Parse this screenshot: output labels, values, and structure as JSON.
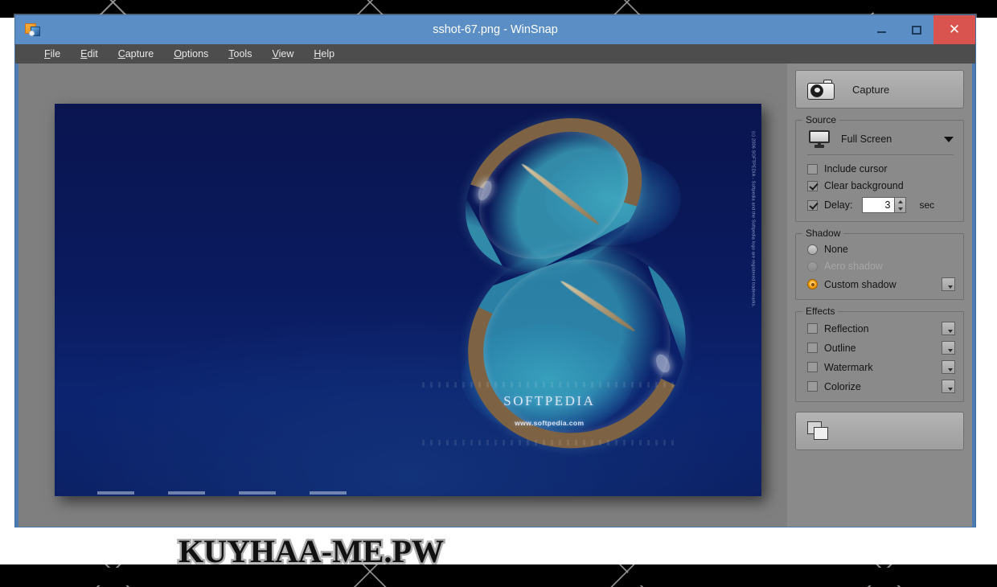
{
  "window": {
    "title": "sshot-67.png - WinSnap",
    "app_icon": "winsnap-app-icon",
    "controls": {
      "minimize": "–",
      "maximize": "□",
      "close": "✕"
    }
  },
  "menubar": {
    "items": [
      {
        "label": "File",
        "accel": "F"
      },
      {
        "label": "Edit",
        "accel": "E"
      },
      {
        "label": "Capture",
        "accel": "C"
      },
      {
        "label": "Options",
        "accel": "O"
      },
      {
        "label": "Tools",
        "accel": "T"
      },
      {
        "label": "View",
        "accel": "V"
      },
      {
        "label": "Help",
        "accel": "H"
      }
    ]
  },
  "panel": {
    "capture_button": {
      "label": "Capture",
      "icon": "camera-icon"
    },
    "source": {
      "legend": "Source",
      "icon": "monitor-icon",
      "selected": "Full Screen",
      "options": [
        "Full Screen"
      ],
      "checkboxes": [
        {
          "label": "Include cursor",
          "checked": false
        },
        {
          "label": "Clear background",
          "checked": true
        }
      ],
      "delay": {
        "label": "Delay:",
        "checked": true,
        "value": "3",
        "unit": "sec"
      }
    },
    "shadow": {
      "legend": "Shadow",
      "selected": "Custom shadow",
      "options": [
        {
          "label": "None",
          "selected": false,
          "disabled": false,
          "has_settings": false
        },
        {
          "label": "Aero shadow",
          "selected": false,
          "disabled": true,
          "has_settings": false
        },
        {
          "label": "Custom shadow",
          "selected": true,
          "disabled": false,
          "has_settings": true
        }
      ]
    },
    "effects": {
      "legend": "Effects",
      "options": [
        {
          "label": "Reflection",
          "checked": false,
          "has_settings": true
        },
        {
          "label": "Outline",
          "checked": false,
          "has_settings": true
        },
        {
          "label": "Watermark",
          "checked": false,
          "has_settings": true
        },
        {
          "label": "Colorize",
          "checked": false,
          "has_settings": true
        }
      ]
    },
    "bottom_button": {
      "label": "",
      "icon": "copy-icon"
    }
  },
  "canvas": {
    "image_description": "aerial-photo-island-s-shape",
    "softpedia": {
      "name": "SOFTPEDIA",
      "url": "www.softpedia.com",
      "copyright": "(c) 2006 SOFTPEDIA - Softpedia and the Softpedia logo are registered trademarks."
    }
  },
  "overlay": {
    "watermark": "KUYHAA-ME.PW"
  },
  "colors": {
    "titlebar": "#5b8ec4",
    "menubar": "#4d4d4d",
    "workspace": "#7f7f7f",
    "panel": "#8a8a8a",
    "close_button": "#d9534f",
    "radio_accent": "#f39800"
  }
}
